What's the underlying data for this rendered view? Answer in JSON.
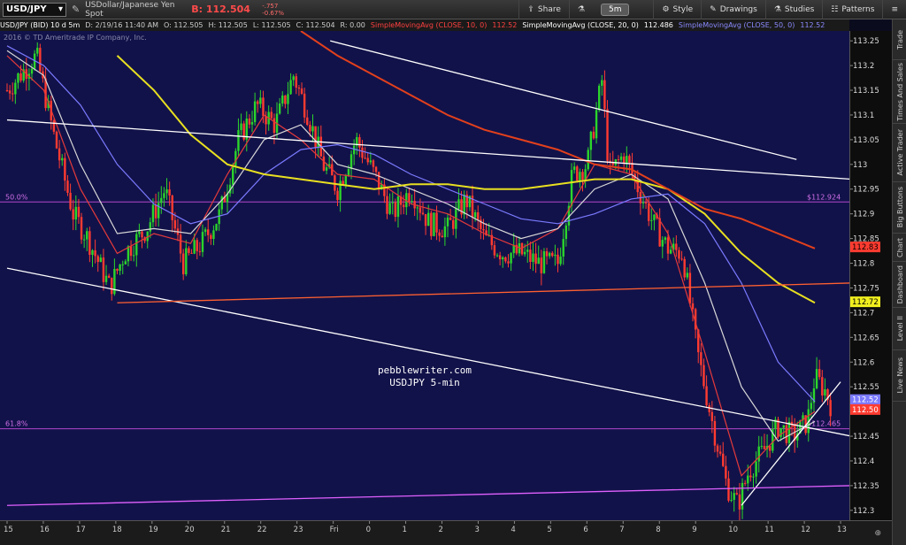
{
  "toolbar": {
    "symbol": "USD/JPY",
    "description": "USDollar/Japanese Yen Spot",
    "bid": "B: 112.504",
    "change_abs": "-.757",
    "change_pct": "-0.67%",
    "timeframe": "5m",
    "share": "Share",
    "style": "Style",
    "drawings": "Drawings",
    "studies": "Studies",
    "patterns": "Patterns"
  },
  "studybar": {
    "instrument": "USD/JPY (BID) 10 d 5m",
    "date": "D: 2/19/16 11:40 AM",
    "open": "O: 112.505",
    "high": "H: 112.505",
    "low": "L: 112.505",
    "close": "C: 112.504",
    "range": "R: 0.00",
    "sma10": "SimpleMovingAvg (CLOSE, 10, 0)",
    "sma10_val": "112.52",
    "sma20": "SimpleMovingAvg (CLOSE, 20, 0)",
    "sma20_val": "112.486",
    "sma50": "SimpleMovingAvg (CLOSE, 50, 0)",
    "sma50_val": "112.52"
  },
  "copyright": "2016 © TD Ameritrade IP Company, Inc.",
  "fib": [
    {
      "label": "50.0%",
      "price_label": "$112.924",
      "value": 112.924
    },
    {
      "label": "61.8%",
      "price_label": "$112.465",
      "value": 112.465
    }
  ],
  "watermark": {
    "line1": "pebblewriter.com",
    "line2": "USDJPY 5-min"
  },
  "y_ticks": [
    "113.25",
    "113.2",
    "113.15",
    "113.1",
    "113.05",
    "113",
    "112.95",
    "112.9",
    "112.85",
    "112.8",
    "112.75",
    "112.7",
    "112.65",
    "112.6",
    "112.55",
    "112.5",
    "112.45",
    "112.4",
    "112.35",
    "112.3"
  ],
  "price_markers": [
    {
      "label": "112.83",
      "value": 112.833,
      "color": "#ff3b30",
      "text_color": "#000000"
    },
    {
      "label": "112.72",
      "value": 112.722,
      "color": "#f0ee1e",
      "text_color": "#000000"
    },
    {
      "label": "112.52",
      "value": 112.524,
      "color": "#7a7aff",
      "text_color": "#ffffff"
    },
    {
      "label": "112.50",
      "value": 112.504,
      "color": "#ff3b30",
      "text_color": "#ffffff"
    }
  ],
  "x_ticks": [
    "15",
    "16",
    "17",
    "18",
    "19",
    "20",
    "21",
    "22",
    "23",
    "Fri",
    "0",
    "1",
    "2",
    "3",
    "4",
    "5",
    "6",
    "7",
    "8",
    "9",
    "10",
    "11",
    "12",
    "13"
  ],
  "side_tabs": [
    "Trade",
    "Times And Sales",
    "Active Trader",
    "Big Buttons",
    "Chart",
    "Dashboard",
    "Level II",
    "Live News"
  ],
  "colors": {
    "bg": "#12124a",
    "up": "#2bd52b",
    "down": "#ff3b30",
    "sma10": "#e43a3a",
    "sma20": "#d8d8d8",
    "sma50": "#7a7aff",
    "sma200": "#e8e020",
    "sma_long": "#e2401c",
    "trend": "#ffffff",
    "fibline": "#b048c8"
  },
  "chart_data": {
    "type": "candlestick",
    "ylim": [
      112.28,
      113.27
    ],
    "x": [
      15,
      16,
      17,
      18,
      19,
      20,
      21,
      22,
      23,
      24,
      25,
      26,
      27,
      28,
      29,
      30,
      31,
      32,
      33,
      34,
      35,
      36,
      37
    ],
    "close_path": [
      [
        15,
        113.15
      ],
      [
        15.8,
        113.22
      ],
      [
        16.3,
        113.05
      ],
      [
        16.8,
        112.9
      ],
      [
        17.2,
        112.85
      ],
      [
        17.8,
        112.75
      ],
      [
        18.2,
        112.82
      ],
      [
        18.8,
        112.87
      ],
      [
        19.3,
        112.95
      ],
      [
        19.8,
        112.8
      ],
      [
        20.3,
        112.84
      ],
      [
        20.8,
        112.9
      ],
      [
        21.3,
        113.05
      ],
      [
        21.8,
        113.12
      ],
      [
        22.3,
        113.08
      ],
      [
        22.8,
        113.18
      ],
      [
        23.2,
        113.1
      ],
      [
        23.6,
        113.0
      ],
      [
        24,
        112.95
      ],
      [
        24.5,
        113.05
      ],
      [
        25,
        112.98
      ],
      [
        25.5,
        112.9
      ],
      [
        26,
        112.95
      ],
      [
        26.5,
        112.88
      ],
      [
        27,
        112.87
      ],
      [
        27.5,
        112.93
      ],
      [
        28,
        112.85
      ],
      [
        28.5,
        112.82
      ],
      [
        29,
        112.82
      ],
      [
        29.5,
        112.8
      ],
      [
        30,
        112.8
      ],
      [
        30.4,
        112.98
      ],
      [
        30.8,
        113.0
      ],
      [
        31.2,
        113.17
      ],
      [
        31.4,
        112.98
      ],
      [
        31.8,
        113.02
      ],
      [
        32.2,
        112.95
      ],
      [
        32.6,
        112.88
      ],
      [
        33,
        112.83
      ],
      [
        33.4,
        112.82
      ],
      [
        33.8,
        112.62
      ],
      [
        34.2,
        112.48
      ],
      [
        34.6,
        112.35
      ],
      [
        34.9,
        112.31
      ],
      [
        35.2,
        112.38
      ],
      [
        35.6,
        112.42
      ],
      [
        36,
        112.47
      ],
      [
        36.4,
        112.45
      ],
      [
        36.8,
        112.48
      ],
      [
        37.0,
        112.57
      ],
      [
        37.3,
        112.54
      ],
      [
        37.5,
        112.5
      ]
    ],
    "series": [
      {
        "name": "SimpleMovingAvg (CLOSE, 10, 0)",
        "color": "#e43a3a",
        "points": [
          [
            15,
            113.22
          ],
          [
            16,
            113.15
          ],
          [
            17,
            112.95
          ],
          [
            18,
            112.82
          ],
          [
            19,
            112.86
          ],
          [
            20,
            112.84
          ],
          [
            21,
            112.98
          ],
          [
            22,
            113.1
          ],
          [
            23,
            113.05
          ],
          [
            24,
            112.98
          ],
          [
            25,
            112.97
          ],
          [
            26,
            112.92
          ],
          [
            27,
            112.9
          ],
          [
            28,
            112.86
          ],
          [
            29,
            112.83
          ],
          [
            30,
            112.87
          ],
          [
            31,
            113.0
          ],
          [
            32,
            112.98
          ],
          [
            33,
            112.86
          ],
          [
            34,
            112.62
          ],
          [
            35,
            112.37
          ],
          [
            36,
            112.45
          ],
          [
            37,
            112.5
          ]
        ]
      },
      {
        "name": "SimpleMovingAvg (CLOSE, 20, 0)",
        "color": "#d8d8d8",
        "points": [
          [
            15,
            113.23
          ],
          [
            16,
            113.18
          ],
          [
            17,
            113.0
          ],
          [
            18,
            112.86
          ],
          [
            19,
            112.87
          ],
          [
            20,
            112.86
          ],
          [
            21,
            112.94
          ],
          [
            22,
            113.05
          ],
          [
            23,
            113.08
          ],
          [
            24,
            113.0
          ],
          [
            25,
            112.98
          ],
          [
            26,
            112.95
          ],
          [
            27,
            112.92
          ],
          [
            28,
            112.88
          ],
          [
            29,
            112.85
          ],
          [
            30,
            112.87
          ],
          [
            31,
            112.95
          ],
          [
            32,
            112.98
          ],
          [
            33,
            112.93
          ],
          [
            34,
            112.76
          ],
          [
            35,
            112.55
          ],
          [
            36,
            112.44
          ],
          [
            37,
            112.48
          ]
        ]
      },
      {
        "name": "SimpleMovingAvg (CLOSE, 50, 0)",
        "color": "#7a7aff",
        "points": [
          [
            15,
            113.24
          ],
          [
            16,
            113.2
          ],
          [
            17,
            113.12
          ],
          [
            18,
            113.0
          ],
          [
            19,
            112.92
          ],
          [
            20,
            112.88
          ],
          [
            21,
            112.9
          ],
          [
            22,
            112.98
          ],
          [
            23,
            113.03
          ],
          [
            24,
            113.04
          ],
          [
            25,
            113.02
          ],
          [
            26,
            112.98
          ],
          [
            27,
            112.95
          ],
          [
            28,
            112.92
          ],
          [
            29,
            112.89
          ],
          [
            30,
            112.88
          ],
          [
            31,
            112.9
          ],
          [
            32,
            112.93
          ],
          [
            33,
            112.94
          ],
          [
            34,
            112.88
          ],
          [
            35,
            112.76
          ],
          [
            36,
            112.6
          ],
          [
            37,
            112.52
          ]
        ]
      },
      {
        "name": "SimpleMovingAvg (CLOSE, 100, 0)",
        "color": "#e8e020",
        "points": [
          [
            18,
            113.22
          ],
          [
            19,
            113.15
          ],
          [
            20,
            113.06
          ],
          [
            21,
            113.0
          ],
          [
            22,
            112.98
          ],
          [
            23,
            112.97
          ],
          [
            24,
            112.96
          ],
          [
            25,
            112.95
          ],
          [
            26,
            112.96
          ],
          [
            27,
            112.96
          ],
          [
            28,
            112.95
          ],
          [
            29,
            112.95
          ],
          [
            30,
            112.96
          ],
          [
            31,
            112.97
          ],
          [
            32,
            112.97
          ],
          [
            33,
            112.95
          ],
          [
            34,
            112.9
          ],
          [
            35,
            112.82
          ],
          [
            36,
            112.76
          ],
          [
            37,
            112.72
          ]
        ]
      },
      {
        "name": "SimpleMovingAvg (CLOSE, 200, 0)",
        "color": "#e2401c",
        "points": [
          [
            23,
            113.27
          ],
          [
            24,
            113.22
          ],
          [
            25,
            113.18
          ],
          [
            26,
            113.14
          ],
          [
            27,
            113.1
          ],
          [
            28,
            113.07
          ],
          [
            29,
            113.05
          ],
          [
            30,
            113.03
          ],
          [
            31,
            113.0
          ],
          [
            32,
            112.99
          ],
          [
            33,
            112.95
          ],
          [
            34,
            112.91
          ],
          [
            35,
            112.89
          ],
          [
            36,
            112.86
          ],
          [
            37,
            112.83
          ]
        ]
      }
    ],
    "trendlines": [
      {
        "p1": [
          15,
          113.09
        ],
        "p2": [
          38,
          112.97
        ]
      },
      {
        "p1": [
          15,
          112.79
        ],
        "p2": [
          38,
          112.45
        ]
      },
      {
        "p1": [
          18,
          112.72
        ],
        "p2": [
          38,
          112.76
        ],
        "color": "#ff6030"
      },
      {
        "p1": [
          23.8,
          113.25
        ],
        "p2": [
          36.5,
          113.01
        ]
      },
      {
        "p1": [
          35,
          112.31
        ],
        "p2": [
          37.7,
          112.56
        ]
      },
      {
        "p1": [
          15,
          112.31
        ],
        "p2": [
          38,
          112.35
        ],
        "color": "#e060ff"
      }
    ]
  }
}
